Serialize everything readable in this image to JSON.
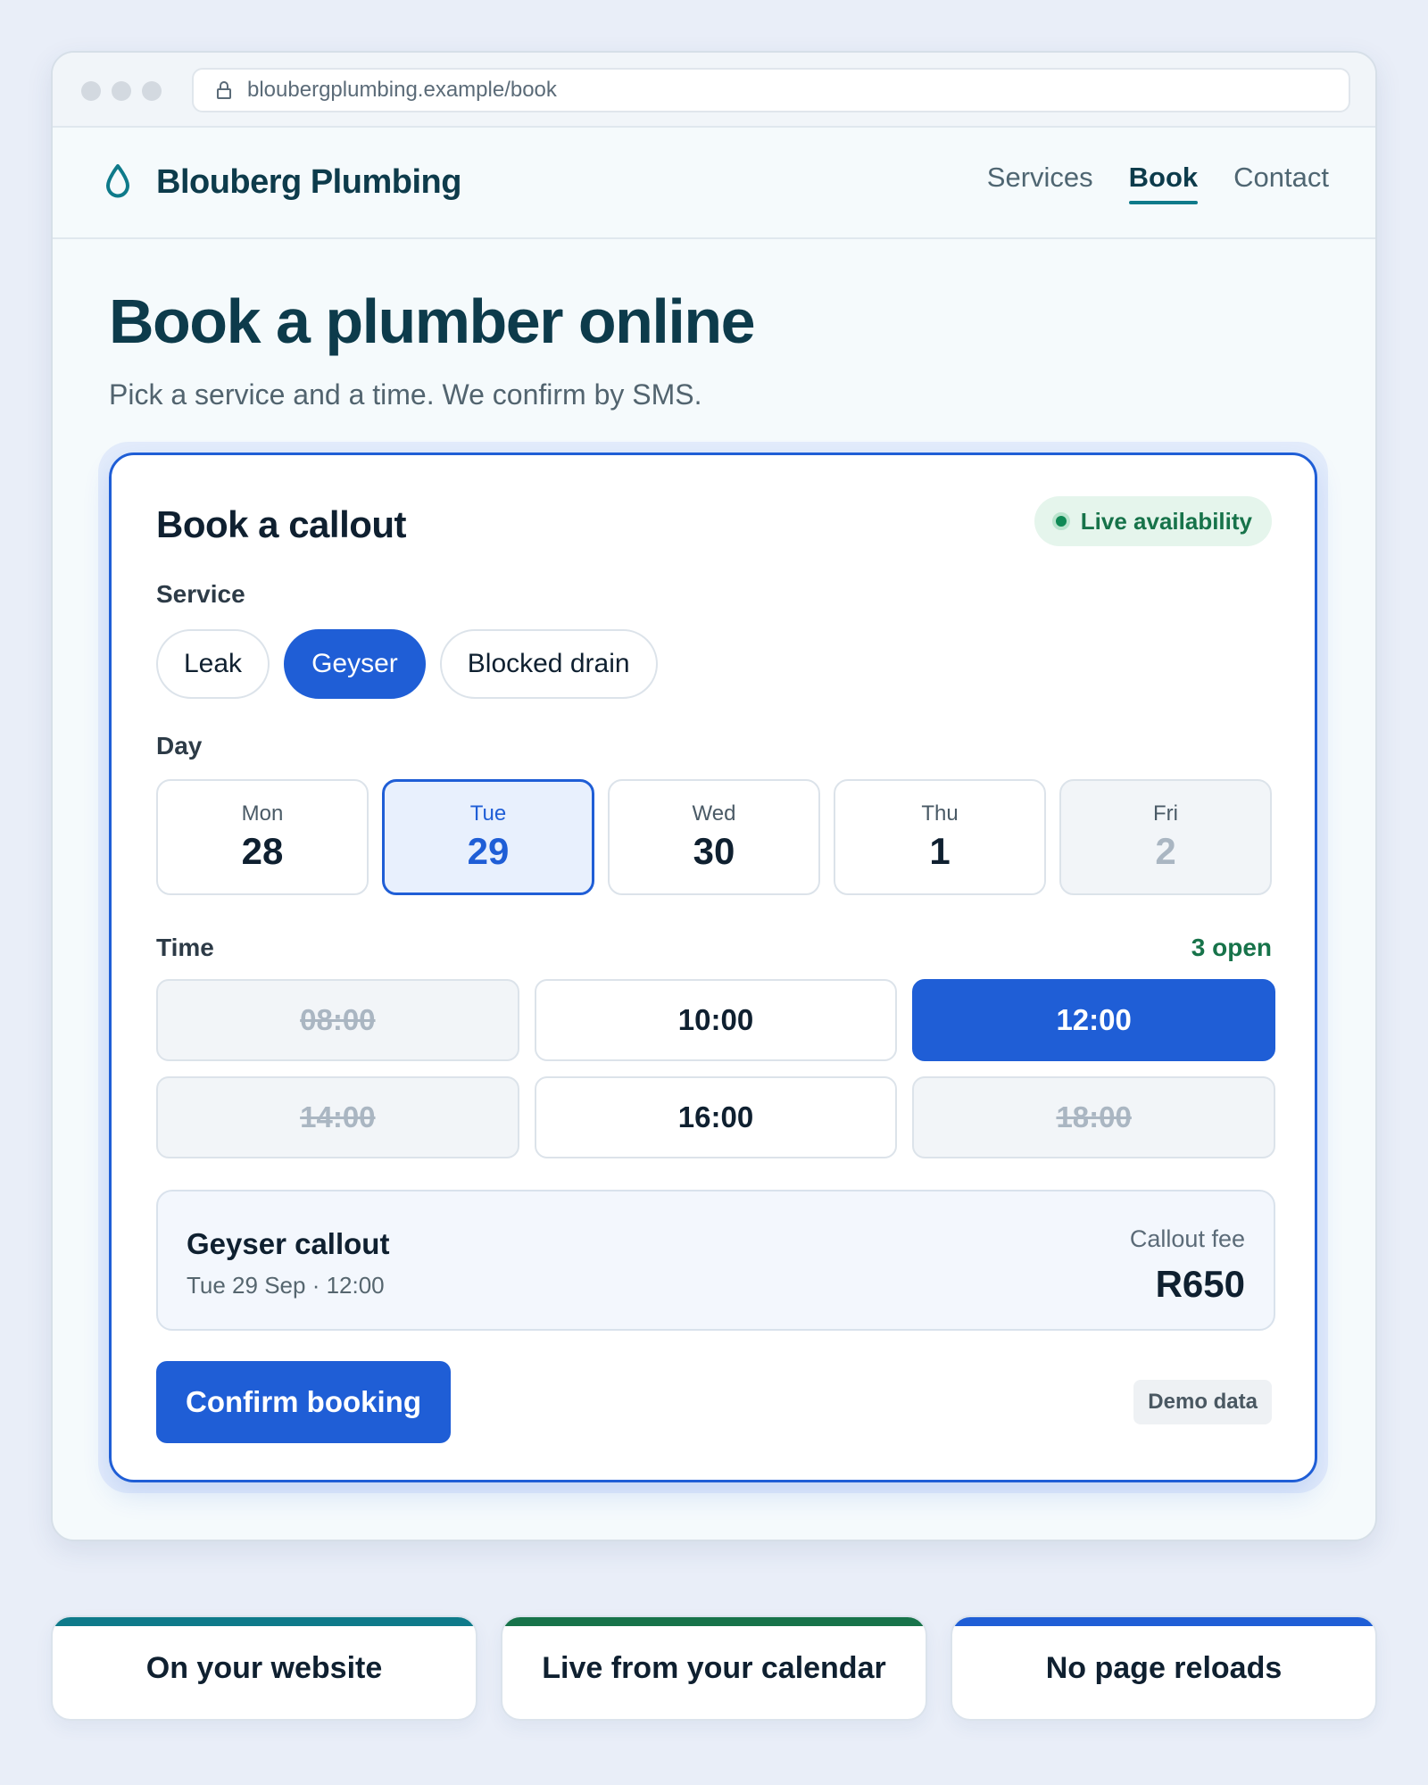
{
  "browser": {
    "url": "bloubergplumbing.example/book"
  },
  "site": {
    "brand": "Blouberg Plumbing",
    "logo_icon": "water-drop-icon",
    "nav": [
      {
        "label": "Services",
        "active": false
      },
      {
        "label": "Book",
        "active": true
      },
      {
        "label": "Contact",
        "active": false
      }
    ]
  },
  "hero": {
    "title": "Book a plumber online",
    "subtitle": "Pick a service and a time. We confirm by SMS."
  },
  "booking": {
    "title": "Book a callout",
    "live_badge": "Live availability",
    "service_label": "Service",
    "services": [
      {
        "label": "Leak",
        "selected": false
      },
      {
        "label": "Geyser",
        "selected": true
      },
      {
        "label": "Blocked drain",
        "selected": false
      }
    ],
    "day_label": "Day",
    "days": [
      {
        "name": "Mon",
        "num": "28",
        "state": "available"
      },
      {
        "name": "Tue",
        "num": "29",
        "state": "selected"
      },
      {
        "name": "Wed",
        "num": "30",
        "state": "available"
      },
      {
        "name": "Thu",
        "num": "1",
        "state": "available"
      },
      {
        "name": "Fri",
        "num": "2",
        "state": "disabled"
      }
    ],
    "time_label": "Time",
    "open_count": "3 open",
    "times": [
      {
        "label": "08:00",
        "state": "taken"
      },
      {
        "label": "10:00",
        "state": "available"
      },
      {
        "label": "12:00",
        "state": "selected"
      },
      {
        "label": "14:00",
        "state": "taken"
      },
      {
        "label": "16:00",
        "state": "available"
      },
      {
        "label": "18:00",
        "state": "taken"
      }
    ],
    "summary": {
      "title": "Geyser callout",
      "when": "Tue 29 Sep · 12:00",
      "fee_label": "Callout fee",
      "fee_value": "R650"
    },
    "confirm_label": "Confirm booking",
    "demo_badge": "Demo data"
  },
  "features": [
    {
      "label": "On your website",
      "accent": "#0e7a8a"
    },
    {
      "label": "Live from your calendar",
      "accent": "#17734a"
    },
    {
      "label": "No page reloads",
      "accent": "#1f5ed6"
    }
  ],
  "colors": {
    "primary": "#1f5ed6",
    "brand_teal": "#0e7a8a",
    "success": "#17734a"
  }
}
